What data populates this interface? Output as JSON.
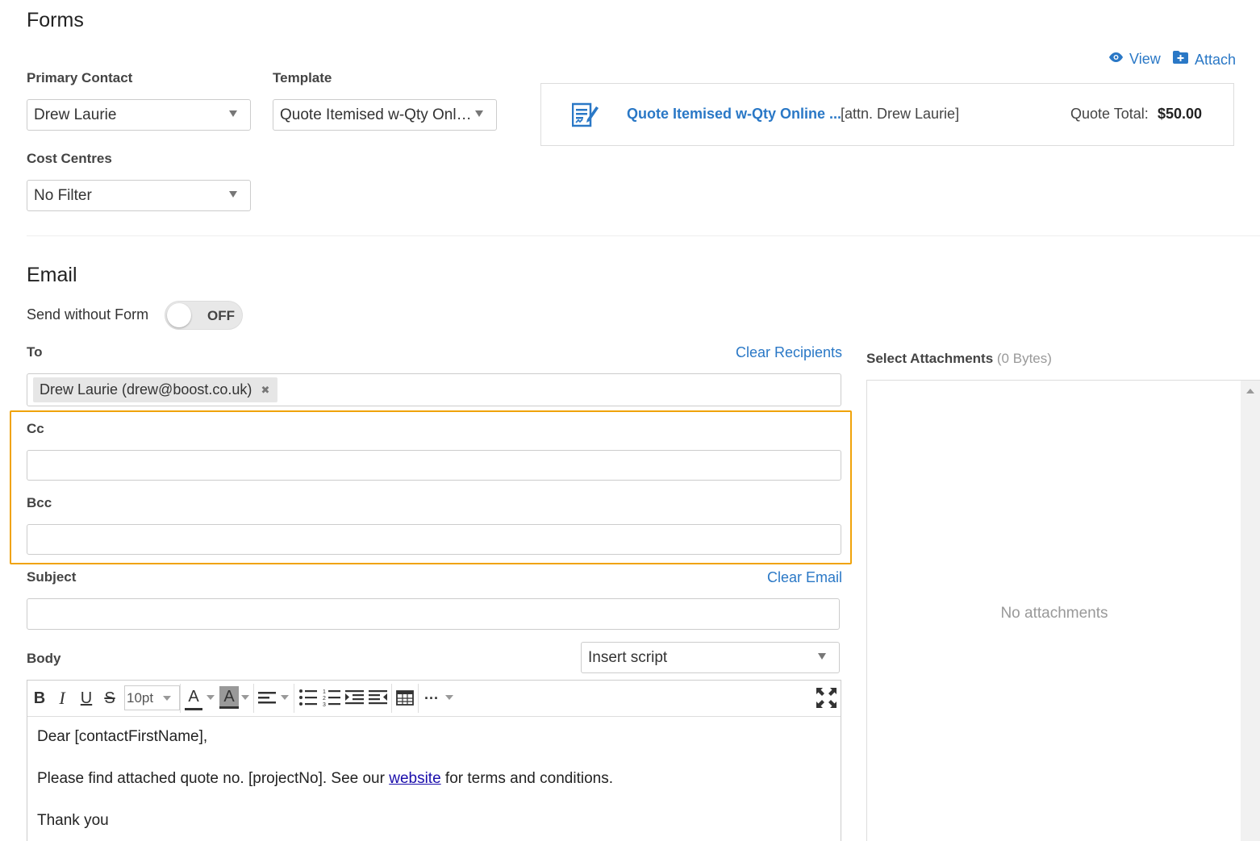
{
  "forms": {
    "title": "Forms",
    "primary_contact_label": "Primary Contact",
    "primary_contact_value": "Drew Laurie",
    "template_label": "Template",
    "template_value": "Quote Itemised w-Qty Onli...",
    "cost_centres_label": "Cost Centres",
    "cost_centres_value": "No Filter",
    "view_label": "View",
    "attach_label": "Attach",
    "form_card": {
      "name": "Quote Itemised w-Qty Online ...",
      "attn": "[attn. Drew Laurie]",
      "total_label": "Quote Total:",
      "total_value": "$50.00"
    }
  },
  "email": {
    "title": "Email",
    "send_without_form_label": "Send without Form",
    "toggle_state": "OFF",
    "to_label": "To",
    "clear_recipients": "Clear Recipients",
    "recipients": [
      {
        "text": "Drew Laurie (drew@boost.co.uk)"
      }
    ],
    "remove_glyph": "✖",
    "cc_label": "Cc",
    "bcc_label": "Bcc",
    "subject_label": "Subject",
    "clear_email": "Clear Email",
    "body_label": "Body",
    "insert_script": "Insert script",
    "font_size": "10pt",
    "body": {
      "line1": "Dear [contactFirstName],",
      "line2_before": "Please find attached quote no. [projectNo]. See our ",
      "line2_link": "website",
      "line2_after": " for terms and conditions.",
      "line3": "Thank you"
    }
  },
  "attachments": {
    "title": "Select Attachments",
    "size": "(0 Bytes)",
    "empty": "No attachments"
  },
  "toolbar": {
    "bold": "B",
    "italic": "I",
    "underline": "U",
    "strike": "S",
    "font_color": "A",
    "highlight": "A",
    "more": "···"
  },
  "colors": {
    "accent": "#2a78c6",
    "highlight_box": "#f0a30a"
  }
}
